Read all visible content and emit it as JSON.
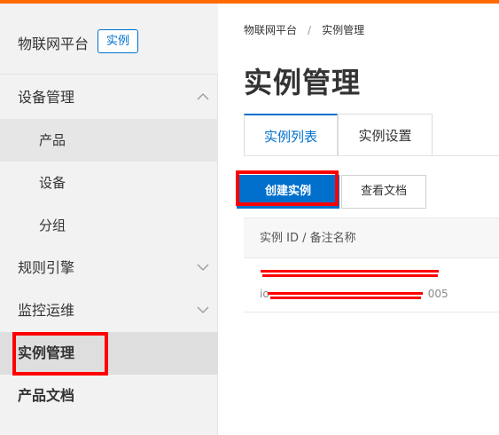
{
  "sidebar": {
    "brand_title": "物联网平台",
    "brand_tag": "实例",
    "items": [
      {
        "label": "设备管理"
      },
      {
        "label": "产品"
      },
      {
        "label": "设备"
      },
      {
        "label": "分组"
      },
      {
        "label": "规则引擎"
      },
      {
        "label": "监控运维"
      },
      {
        "label": "实例管理"
      },
      {
        "label": "产品文档"
      }
    ]
  },
  "breadcrumb": {
    "root": "物联网平台",
    "separator": "/",
    "current": "实例管理"
  },
  "page_title": "实例管理",
  "tabs": [
    {
      "label": "实例列表"
    },
    {
      "label": "实例设置"
    }
  ],
  "toolbar": {
    "create_label": "创建实例",
    "docs_label": "查看文档"
  },
  "table": {
    "header": "实例 ID / 备注名称",
    "rows": [
      {
        "name": "",
        "id_prefix": "io",
        "id_suffix": "005"
      }
    ]
  },
  "colors": {
    "accent": "#0070cc",
    "topbar": "#ff6a00",
    "annotation": "#ff0000"
  }
}
